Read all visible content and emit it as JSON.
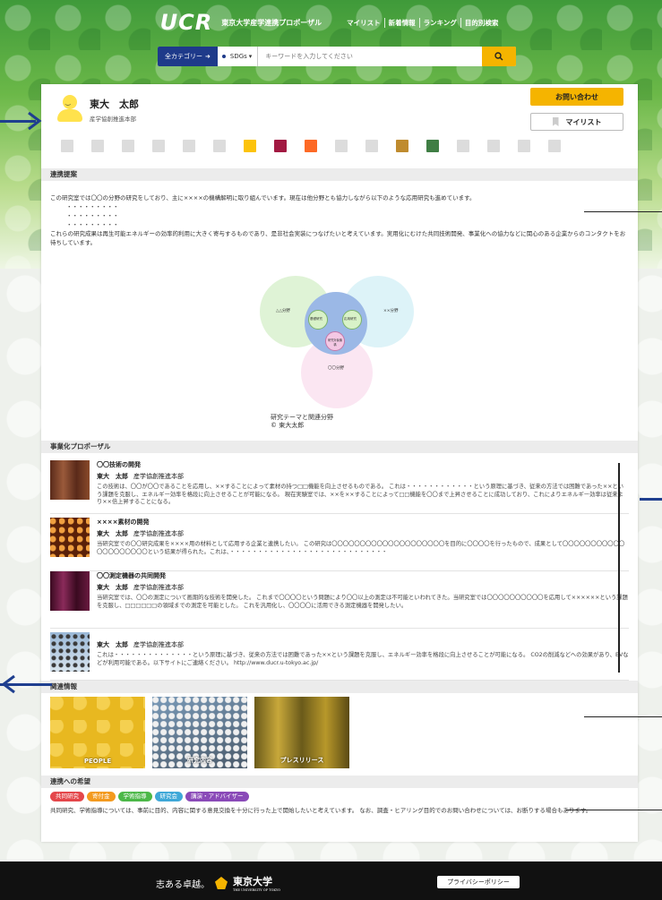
{
  "header": {
    "logo": "UCR",
    "site_title": "東京大学産学連携プロポーザル",
    "nav": [
      "マイリスト",
      "新着情報",
      "ランキング",
      "目的別検索"
    ]
  },
  "search": {
    "category": "全カテゴリー",
    "sdgs": "SDGs",
    "placeholder": "キーワードを入力してください"
  },
  "profile": {
    "name": "東大　太郎",
    "dept": "産学協創推進本部",
    "contact_label": "お問い合わせ",
    "mylist_label": "マイリスト"
  },
  "sdg_icons": [
    {
      "color": "#dcdcdc",
      "active": false
    },
    {
      "color": "#dcdcdc",
      "active": false
    },
    {
      "color": "#dcdcdc",
      "active": false
    },
    {
      "color": "#dcdcdc",
      "active": false
    },
    {
      "color": "#dcdcdc",
      "active": false
    },
    {
      "color": "#dcdcdc",
      "active": false
    },
    {
      "color": "#fcc30b",
      "active": true
    },
    {
      "color": "#a21942",
      "active": true
    },
    {
      "color": "#fd6925",
      "active": true
    },
    {
      "color": "#dcdcdc",
      "active": false
    },
    {
      "color": "#dcdcdc",
      "active": false
    },
    {
      "color": "#bf8b2e",
      "active": true
    },
    {
      "color": "#3f7e44",
      "active": true
    },
    {
      "color": "#dcdcdc",
      "active": false
    },
    {
      "color": "#dcdcdc",
      "active": false
    },
    {
      "color": "#dcdcdc",
      "active": false
    },
    {
      "color": "#dcdcdc",
      "active": false
    }
  ],
  "collab": {
    "heading": "連携提案",
    "para1": "この研究室では〇〇の分野の研究をしており、主に××××の機構解明に取り組んでいます。現在は他分野とも協力しながら以下のような応用研究も進めています。",
    "dots1": "・・・・・・・・・",
    "dots2": "・・・・・・・・・",
    "dots3": "・・・・・・・・・",
    "para2": "これらの研究成果は再生可能エネルギーの効率的利用に大きく寄与するものであり、是非社会実装につなげたいと考えています。実用化にむけた共同技術開発、事業化への協力などに関心のある企業からのコンタクトをお待ちしています。",
    "venn": {
      "left": "△△分野",
      "right": "××分野",
      "bottom": "〇〇分野",
      "inner_left": "基礎研究",
      "inner_right": "応用研究",
      "inner_center": "研究対象機構"
    },
    "caption1": "研究テーマと関連分野",
    "caption2": "© 東大太郎"
  },
  "proposals": {
    "heading": "事業化プロポーザル",
    "items": [
      {
        "title": "〇〇技術の開発",
        "author": "東大　太郎",
        "dept": "産学協創推進本部",
        "desc": "この技術は、〇〇が〇〇であることを応用し、××することによって素材の持つ□□機能を向上させるものである。 これは・・・・・・・・・・・・という原理に基づき、従来の方法では困難であった××という課題を克服し、エネルギー効率を格段に向上させることが可能になる。 現在実験室では、××を××することによって□□機能を〇〇まで上昇させることに成功しており、これによりエネルギー効率は従来より××倍上昇することになる。",
        "thumb": "#7a3b2a"
      },
      {
        "title": "××××素材の開発",
        "author": "東大　太郎",
        "dept": "産学協創推進本部",
        "desc": "当研究室での〇〇研究成果を××××用の材料として応用する企業と連携したい。 この研究は〇〇〇〇〇〇〇〇〇〇〇〇〇〇〇〇〇〇〇〇を目的に〇〇〇〇を行ったもので、成果として〇〇〇〇〇〇〇〇〇〇〇〇〇〇〇〇〇〇〇〇という結果が得られた。これは、・・・・・・・・・・・・・・・・・・・・・・・・・・・・",
        "thumb": "#b4501a"
      },
      {
        "title": "〇〇測定機器の共同開発",
        "author": "東大　太郎",
        "dept": "産学協創推進本部",
        "desc": "当研究室では、〇〇の測定について画期的な技術を開発した。 これまで〇〇〇〇という問題により〇〇以上の測定は不可能といわれてきた。当研究室では〇〇〇〇〇〇〇〇〇〇を応用して××××××という課題を克服し、□□□□□□の領域までの測定を可能とした。 これを汎用化し、〇〇〇〇に活用できる測定機器を開発したい。",
        "thumb": "#5a1a3a"
      },
      {
        "title": "",
        "author": "東大　太郎",
        "dept": "産学協創推進本部",
        "desc": "これは・・・・・・・・・・・・・・という原理に基づき、従来の方法では困難であった××という課題を克服し、エネルギー効率を格段に向上させることが可能になる。 CO2の削減などへの効果があり、EVなどが利用可能である。以下サイトにご連絡ください。 http://www.ducr.u-tokyo.ac.jp/",
        "thumb": "#7a9ab8"
      }
    ]
  },
  "related": {
    "heading": "関連情報",
    "tiles": [
      {
        "label": "PEOPLE",
        "color": "#e8b820"
      },
      {
        "label": "研究内容",
        "color": "#6a7f96"
      },
      {
        "label": "プレスリリース",
        "color": "#8a7a2a"
      }
    ]
  },
  "hope": {
    "heading": "連携への希望",
    "tags": [
      {
        "label": "共同研究",
        "color": "#e4474b"
      },
      {
        "label": "寄付金",
        "color": "#f39a1f"
      },
      {
        "label": "学術指導",
        "color": "#4cb848"
      },
      {
        "label": "研究会",
        "color": "#3fa8d8"
      },
      {
        "label": "講演・アドバイザー",
        "color": "#8a4ab8"
      }
    ],
    "text": "共同研究、学術指導については、事前に目的、内容に関する意見交換を十分に行った上で開始したいと考えています。 なお、調査・ヒアリング目的でのお問い合わせについては、お断りする場合もあります。"
  },
  "footer": {
    "motto": "志ある卓越。",
    "univ": "東京大学",
    "univ_en": "THE UNIVERSITY OF TOKYO",
    "privacy": "プライバシーポリシー"
  }
}
